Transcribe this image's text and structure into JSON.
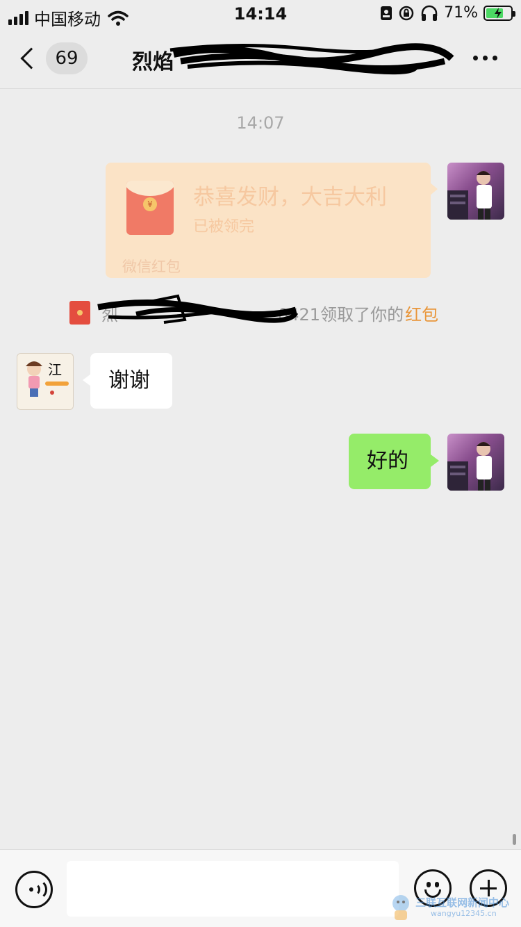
{
  "status_bar": {
    "carrier": "中国移动",
    "time": "14:14",
    "battery_percent": "71%",
    "icons": [
      "signal-icon",
      "wifi-icon",
      "id-card-icon",
      "rotation-lock-icon",
      "headphones-icon",
      "battery-charging-icon"
    ]
  },
  "nav": {
    "unread_count": "69",
    "chat_title": "烈焰",
    "more_icon": "more-dots-icon"
  },
  "chat": {
    "timestamp": "14:07",
    "red_packet": {
      "title": "恭喜发财，大吉大利",
      "status": "已被领完",
      "footer": "微信红包",
      "coin_glyph": "¥"
    },
    "system_note": {
      "prefix": "烈",
      "text": "0421领取了你的",
      "link": "红包"
    },
    "received_message": "谢谢",
    "sent_message": "好的"
  },
  "input_bar": {
    "placeholder": "",
    "icons": [
      "voice-icon",
      "emoji-icon",
      "plus-icon"
    ]
  },
  "watermark": {
    "text": "三联互联网新闻中心",
    "sub": "wangyu12345.cn"
  },
  "colors": {
    "background": "#ededed",
    "sent_bubble": "#95ec69",
    "received_bubble": "#ffffff",
    "red_packet_opened": "#fbe3c6",
    "system_link": "#e9963a"
  }
}
